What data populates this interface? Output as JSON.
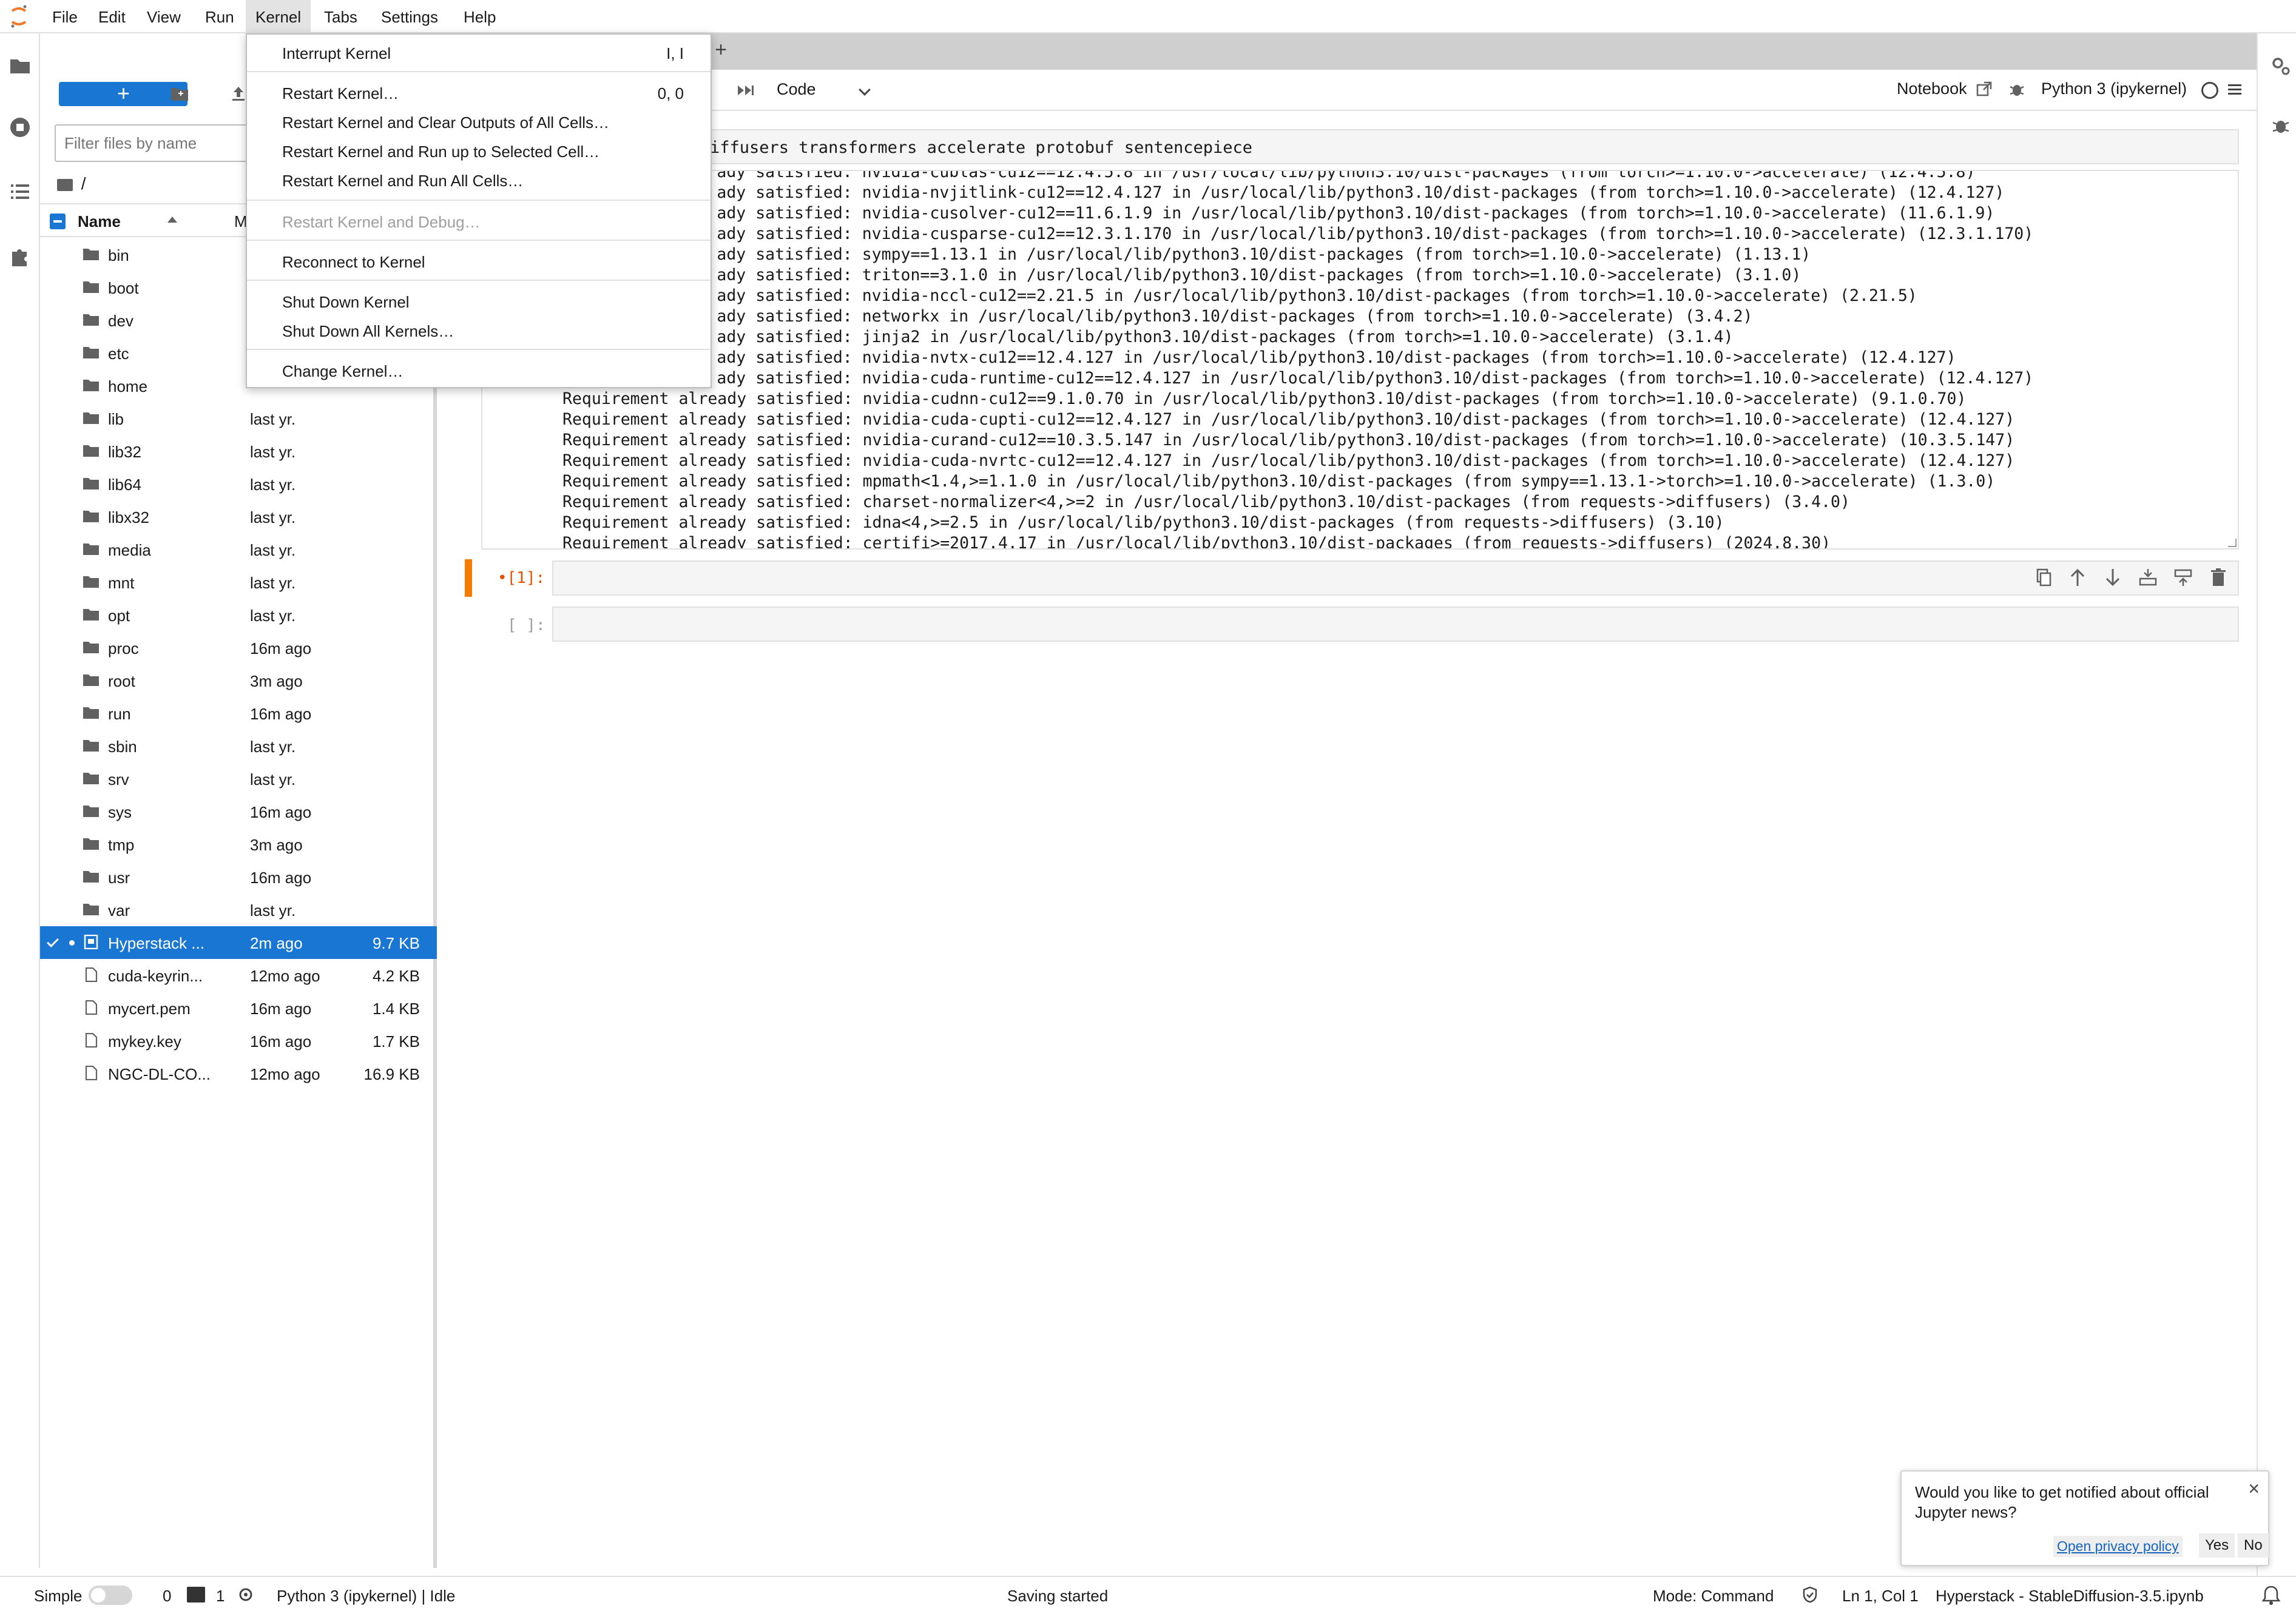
{
  "menubar": {
    "items": [
      "File",
      "Edit",
      "View",
      "Run",
      "Kernel",
      "Tabs",
      "Settings",
      "Help"
    ],
    "open_menu": "Kernel"
  },
  "kernel_menu": {
    "items": [
      {
        "label": "Interrupt Kernel",
        "shortcut": "I, I",
        "enabled": true
      },
      {
        "label": "Restart Kernel…",
        "shortcut": "0, 0",
        "enabled": true
      },
      {
        "label": "Restart Kernel and Clear Outputs of All Cells…",
        "shortcut": "",
        "enabled": true
      },
      {
        "label": "Restart Kernel and Run up to Selected Cell…",
        "shortcut": "",
        "enabled": true
      },
      {
        "label": "Restart Kernel and Run All Cells…",
        "shortcut": "",
        "enabled": true
      },
      {
        "label": "Restart Kernel and Debug…",
        "shortcut": "",
        "enabled": false
      },
      {
        "label": "Reconnect to Kernel",
        "shortcut": "",
        "enabled": true
      },
      {
        "label": "Shut Down Kernel",
        "shortcut": "",
        "enabled": true
      },
      {
        "label": "Shut Down All Kernels…",
        "shortcut": "",
        "enabled": true
      },
      {
        "label": "Change Kernel…",
        "shortcut": "",
        "enabled": true
      }
    ]
  },
  "filebrowser": {
    "new_button": "+",
    "filter_placeholder": "Filter files by name",
    "breadcrumb": "/",
    "columns": {
      "name": "Name",
      "modified": "M"
    },
    "rows": [
      {
        "name": "bin",
        "modified": "",
        "size": "",
        "type": "folder"
      },
      {
        "name": "boot",
        "modified": "",
        "size": "",
        "type": "folder"
      },
      {
        "name": "dev",
        "modified": "",
        "size": "",
        "type": "folder"
      },
      {
        "name": "etc",
        "modified": "",
        "size": "",
        "type": "folder"
      },
      {
        "name": "home",
        "modified": "",
        "size": "",
        "type": "folder"
      },
      {
        "name": "lib",
        "modified": "last yr.",
        "size": "",
        "type": "folder"
      },
      {
        "name": "lib32",
        "modified": "last yr.",
        "size": "",
        "type": "folder"
      },
      {
        "name": "lib64",
        "modified": "last yr.",
        "size": "",
        "type": "folder"
      },
      {
        "name": "libx32",
        "modified": "last yr.",
        "size": "",
        "type": "folder"
      },
      {
        "name": "media",
        "modified": "last yr.",
        "size": "",
        "type": "folder"
      },
      {
        "name": "mnt",
        "modified": "last yr.",
        "size": "",
        "type": "folder"
      },
      {
        "name": "opt",
        "modified": "last yr.",
        "size": "",
        "type": "folder"
      },
      {
        "name": "proc",
        "modified": "16m ago",
        "size": "",
        "type": "folder"
      },
      {
        "name": "root",
        "modified": "3m ago",
        "size": "",
        "type": "folder"
      },
      {
        "name": "run",
        "modified": "16m ago",
        "size": "",
        "type": "folder"
      },
      {
        "name": "sbin",
        "modified": "last yr.",
        "size": "",
        "type": "folder"
      },
      {
        "name": "srv",
        "modified": "last yr.",
        "size": "",
        "type": "folder"
      },
      {
        "name": "sys",
        "modified": "16m ago",
        "size": "",
        "type": "folder"
      },
      {
        "name": "tmp",
        "modified": "3m ago",
        "size": "",
        "type": "folder"
      },
      {
        "name": "usr",
        "modified": "16m ago",
        "size": "",
        "type": "folder"
      },
      {
        "name": "var",
        "modified": "last yr.",
        "size": "",
        "type": "folder"
      },
      {
        "name": "Hyperstack ...",
        "modified": "2m ago",
        "size": "9.7 KB",
        "type": "notebook",
        "selected": true
      },
      {
        "name": "cuda-keyrin...",
        "modified": "12mo ago",
        "size": "4.2 KB",
        "type": "file"
      },
      {
        "name": "mycert.pem",
        "modified": "16m ago",
        "size": "1.4 KB",
        "type": "file"
      },
      {
        "name": "mykey.key",
        "modified": "16m ago",
        "size": "1.7 KB",
        "type": "file"
      },
      {
        "name": "NGC-DL-CO...",
        "modified": "12mo ago",
        "size": "16.9 KB",
        "type": "file"
      }
    ]
  },
  "notebook_toolbar": {
    "cell_type": "Code",
    "notebook_label": "Notebook",
    "kernel_label": "Python 3 (ipykernel)"
  },
  "cell_input_text": "iffusers transformers accelerate protobuf sentencepiece",
  "output_lines": [
    {
      "prefix": "",
      "text": "ady satisfied: nvidia-cublas-cu12==12.4.5.8 in /usr/local/lib/python3.10/dist-packages (from torch>=1.10.0->accelerate) (12.4.5.8)"
    },
    {
      "prefix": "",
      "text": "ady satisfied: nvidia-nvjitlink-cu12==12.4.127 in /usr/local/lib/python3.10/dist-packages (from torch>=1.10.0->accelerate) (12.4.127)"
    },
    {
      "prefix": "",
      "text": "ady satisfied: nvidia-cusolver-cu12==11.6.1.9 in /usr/local/lib/python3.10/dist-packages (from torch>=1.10.0->accelerate) (11.6.1.9)"
    },
    {
      "prefix": "",
      "text": "ady satisfied: nvidia-cusparse-cu12==12.3.1.170 in /usr/local/lib/python3.10/dist-packages (from torch>=1.10.0->accelerate) (12.3.1.170)"
    },
    {
      "prefix": "",
      "text": "ady satisfied: sympy==1.13.1 in /usr/local/lib/python3.10/dist-packages (from torch>=1.10.0->accelerate) (1.13.1)"
    },
    {
      "prefix": "",
      "text": "ady satisfied: triton==3.1.0 in /usr/local/lib/python3.10/dist-packages (from torch>=1.10.0->accelerate) (3.1.0)"
    },
    {
      "prefix": "",
      "text": "ady satisfied: nvidia-nccl-cu12==2.21.5 in /usr/local/lib/python3.10/dist-packages (from torch>=1.10.0->accelerate) (2.21.5)"
    },
    {
      "prefix": "",
      "text": "ady satisfied: networkx in /usr/local/lib/python3.10/dist-packages (from torch>=1.10.0->accelerate) (3.4.2)"
    },
    {
      "prefix": "",
      "text": "ady satisfied: jinja2 in /usr/local/lib/python3.10/dist-packages (from torch>=1.10.0->accelerate) (3.1.4)"
    },
    {
      "prefix": "",
      "text": "ady satisfied: nvidia-nvtx-cu12==12.4.127 in /usr/local/lib/python3.10/dist-packages (from torch>=1.10.0->accelerate) (12.4.127)"
    },
    {
      "prefix": "",
      "text": "ady satisfied: nvidia-cuda-runtime-cu12==12.4.127 in /usr/local/lib/python3.10/dist-packages (from torch>=1.10.0->accelerate) (12.4.127)"
    },
    {
      "prefix": "Requirement alre",
      "text": "ady satisfied: nvidia-cudnn-cu12==9.1.0.70 in /usr/local/lib/python3.10/dist-packages (from torch>=1.10.0->accelerate) (9.1.0.70)"
    },
    {
      "prefix": "Requirement alre",
      "text": "ady satisfied: nvidia-cuda-cupti-cu12==12.4.127 in /usr/local/lib/python3.10/dist-packages (from torch>=1.10.0->accelerate) (12.4.127)"
    },
    {
      "prefix": "Requirement alre",
      "text": "ady satisfied: nvidia-curand-cu12==10.3.5.147 in /usr/local/lib/python3.10/dist-packages (from torch>=1.10.0->accelerate) (10.3.5.147)"
    },
    {
      "prefix": "Requirement alre",
      "text": "ady satisfied: nvidia-cuda-nvrtc-cu12==12.4.127 in /usr/local/lib/python3.10/dist-packages (from torch>=1.10.0->accelerate) (12.4.127)"
    },
    {
      "prefix": "Requirement alre",
      "text": "ady satisfied: mpmath<1.4,>=1.1.0 in /usr/local/lib/python3.10/dist-packages (from sympy==1.13.1->torch>=1.10.0->accelerate) (1.3.0)"
    },
    {
      "prefix": "Requirement alre",
      "text": "ady satisfied: charset-normalizer<4,>=2 in /usr/local/lib/python3.10/dist-packages (from requests->diffusers) (3.4.0)"
    },
    {
      "prefix": "Requirement alre",
      "text": "ady satisfied: idna<4,>=2.5 in /usr/local/lib/python3.10/dist-packages (from requests->diffusers) (3.10)"
    },
    {
      "prefix": "Requirement alre",
      "text": "ady satisfied: certifi>=2017.4.17 in /usr/local/lib/python3.10/dist-packages (from requests->diffusers) (2024.8.30)"
    }
  ],
  "cells": {
    "active_prompt": "•[1]:",
    "empty_prompt": "[ ]:"
  },
  "notification": {
    "text": "Would you like to get notified about official Jupyter news?",
    "link": "Open privacy policy",
    "yes": "Yes",
    "no": "No",
    "close": "×"
  },
  "statusbar": {
    "mode_label": "Simple",
    "terminals": "0",
    "kernels": "1",
    "kernel_status": "Python 3 (ipykernel) | Idle",
    "saving": "Saving started",
    "mode": "Mode: Command",
    "position": "Ln 1, Col 1",
    "filename": "Hyperstack - StableDiffusion-3.5.ipynb"
  },
  "colors": {
    "accent": "#1976d2",
    "active_cell": "#f57c00",
    "tab_bar": "#cfcfcf"
  }
}
